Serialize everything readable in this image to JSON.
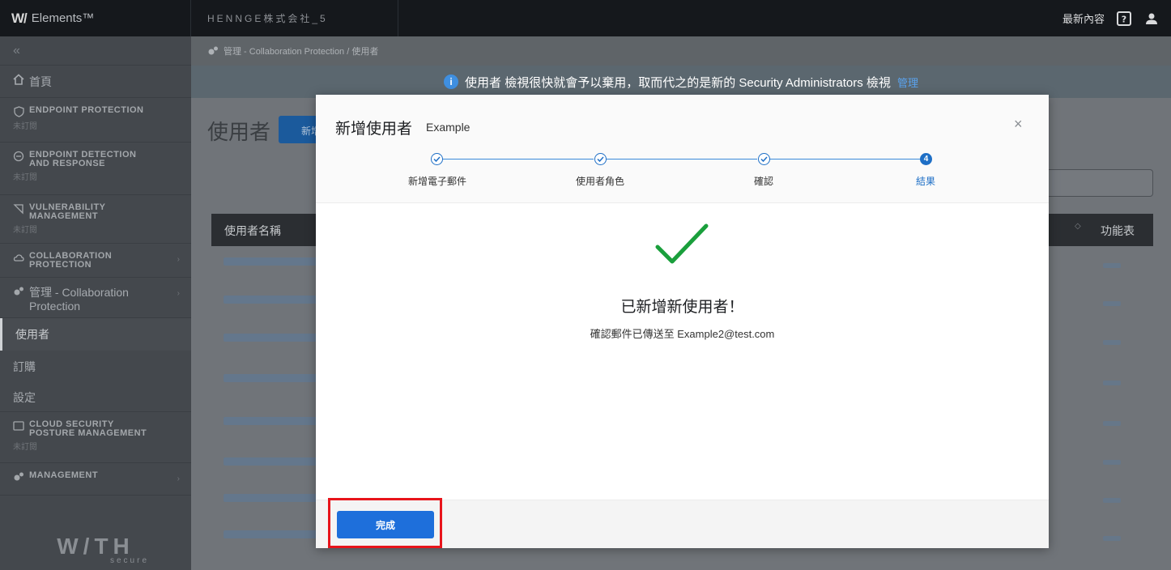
{
  "topbar": {
    "logo": "W/",
    "app_name": "Elements™",
    "org": "HENNGE株式会社_5",
    "whats_new": "最新內容",
    "icons": [
      "help-icon",
      "user-icon"
    ]
  },
  "sidebar": {
    "collapse": "«",
    "home": "首頁",
    "items": [
      {
        "title": "ENDPOINT PROTECTION",
        "sub": "未訂閱"
      },
      {
        "title": "ENDPOINT DETECTION",
        "title2": "AND RESPONSE",
        "sub": "未訂閱"
      },
      {
        "title": "VULNERABILITY",
        "title2": "MANAGEMENT",
        "sub": "未訂閱"
      },
      {
        "title": "COLLABORATION",
        "title2": "PROTECTION"
      },
      {
        "title": "管理 - Collaboration",
        "title2": "Protection"
      },
      {
        "title": "使用者"
      },
      {
        "title": "訂購"
      },
      {
        "title": "設定"
      },
      {
        "title": "CLOUD SECURITY",
        "title2": "POSTURE MANAGEMENT",
        "sub": "未訂閱"
      },
      {
        "title": "MANAGEMENT"
      }
    ],
    "footer_logo": "W/TH",
    "footer_sub": "secure"
  },
  "breadcrumb": "管理 - Collaboration Protection / 使用者",
  "banner": {
    "text": "使用者 檢視很快就會予以棄用，取而代之的是新的 Security Administrators 檢視",
    "link": "管理"
  },
  "page": {
    "title": "使用者",
    "new_button": "新增",
    "table_header_name": "使用者名稱",
    "table_header_menu": "功能表"
  },
  "modal": {
    "title": "新增使用者",
    "subtitle": "Example",
    "close": "×",
    "steps": [
      {
        "label": "新增電子郵件",
        "state": "done"
      },
      {
        "label": "使用者角色",
        "state": "done"
      },
      {
        "label": "確認",
        "state": "done"
      },
      {
        "label": "結果",
        "state": "current",
        "number": "4"
      }
    ],
    "success_title": "已新增新使用者！",
    "success_detail": "確認郵件已傳送至 Example2@test.com",
    "done_button": "完成"
  },
  "colors": {
    "accent": "#1e6fdb",
    "success": "#1a9f3c",
    "highlight": "#e8141b"
  }
}
